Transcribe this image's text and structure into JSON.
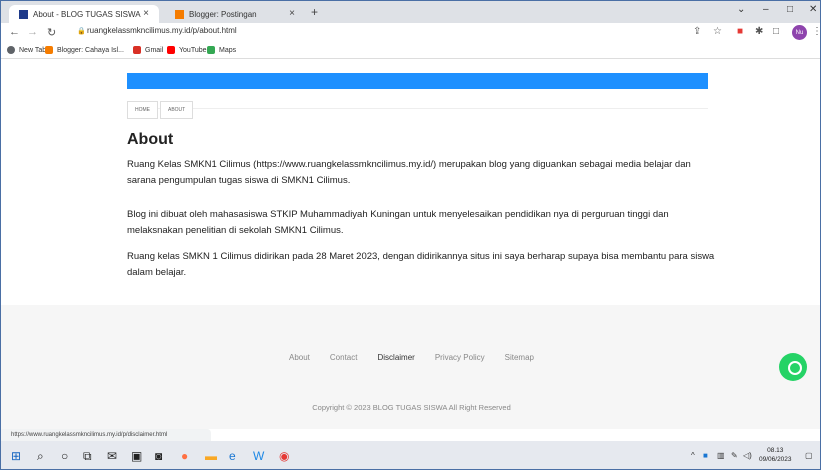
{
  "browser": {
    "tabs": [
      {
        "label": "About - BLOG TUGAS SISWA",
        "close": "×"
      },
      {
        "label": "Blogger: Postingan",
        "close": "×"
      }
    ],
    "new_tab": "+",
    "window_controls": {
      "chevron": "⌄",
      "minimize": "–",
      "maximize": "□",
      "close": "✕"
    },
    "url": "ruangkelassmkncilimus.my.id/p/about.html",
    "profile_initials": "Nu",
    "bookmarks": [
      "New Tab",
      "Blogger: Cahaya Isl...",
      "Gmail",
      "YouTube",
      "Maps"
    ]
  },
  "site": {
    "menu": [
      "HOME",
      "ABOUT"
    ],
    "title": "About",
    "paragraphs": [
      "Ruang Kelas SMKN1 Cilimus (https://www.ruangkelassmkncilimus.my.id/) merupakan blog yang diguankan sebagai media belajar dan sarana pengumpulan tugas siswa di SMKN1 Cilimus.",
      "Blog ini dibuat oleh mahasasiswa STKIP Muhammadiyah Kuningan untuk menyelesaikan pendidikan nya di perguruan tinggi dan melaksnakan penelitian di sekolah SMKN1 Cilimus.",
      "Ruang kelas SMKN 1 Cilimus didirikan pada 28 Maret 2023, dengan didirikannya situs ini saya berharap supaya bisa membantu para siswa dalam belajar."
    ],
    "footer_links": [
      "About",
      "Contact",
      "Disclaimer",
      "Privacy Policy",
      "Sitemap"
    ],
    "copyright": "Copyright © 2023 BLOG TUGAS SISWA All Right Reserved"
  },
  "status_url": "https://www.ruangkelassmkncilimus.my.id/p/disclaimer.html",
  "taskbar": {
    "time": "08.13",
    "date": "09/06/2023"
  },
  "colors": {
    "accent": "#1e90ff",
    "whatsapp": "#25d366"
  }
}
